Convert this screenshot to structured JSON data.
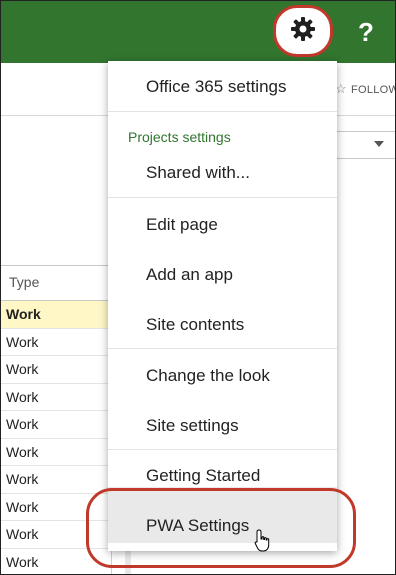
{
  "header": {
    "gear_icon": "gear-icon",
    "help_label": "?",
    "accent_color": "#31752f",
    "highlight_color": "#c0392b"
  },
  "subbar": {
    "follow_label": "FOLLOW"
  },
  "grid": {
    "header": "Type",
    "rows": [
      "Work",
      "Work",
      "Work",
      "Work",
      "Work",
      "Work",
      "Work",
      "Work",
      "Work",
      "Work"
    ]
  },
  "menu": {
    "office365": "Office 365 settings",
    "section_title": "Projects settings",
    "shared_with": "Shared with...",
    "edit_page": "Edit page",
    "add_app": "Add an app",
    "site_contents": "Site contents",
    "change_look": "Change the look",
    "site_settings": "Site settings",
    "getting_started": "Getting Started",
    "pwa_settings": "PWA Settings"
  }
}
